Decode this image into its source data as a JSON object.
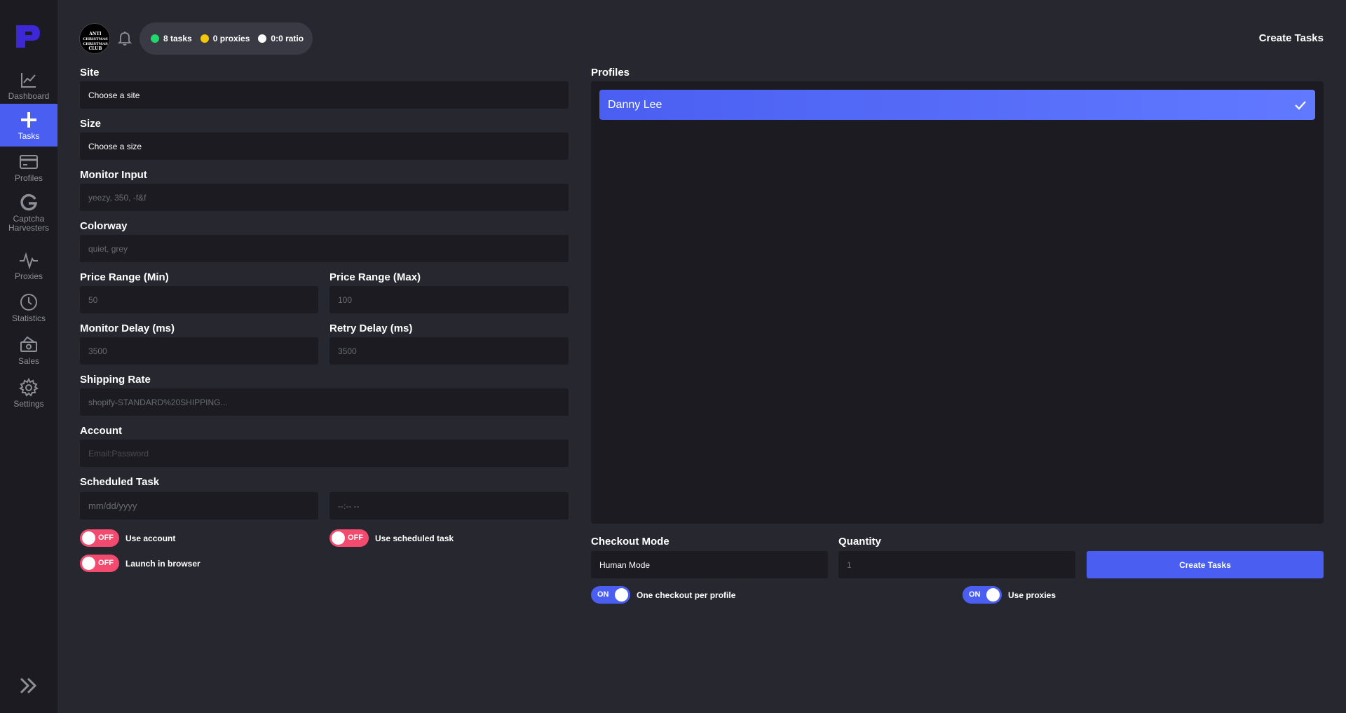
{
  "sidebar": {
    "items": [
      {
        "label": "Dashboard"
      },
      {
        "label": "Tasks"
      },
      {
        "label": "Profiles"
      },
      {
        "label": "Captcha Harvesters"
      },
      {
        "label": "Proxies"
      },
      {
        "label": "Statistics"
      },
      {
        "label": "Sales"
      },
      {
        "label": "Settings"
      }
    ],
    "active_index": 1,
    "accent": "#4a5ff1"
  },
  "header": {
    "avatar_text": "ANTI CHRISTMAS CHRISTMAS CLUB",
    "stats": {
      "tasks": "8 tasks",
      "proxies": "0 proxies",
      "ratio": "0:0 ratio"
    },
    "title": "Create Tasks"
  },
  "form": {
    "site": {
      "label": "Site",
      "value": "Choose a site"
    },
    "size": {
      "label": "Size",
      "value": "Choose a size"
    },
    "monitor_input": {
      "label": "Monitor Input",
      "placeholder": "yeezy, 350, -f&f"
    },
    "colorway": {
      "label": "Colorway",
      "placeholder": "quiet, grey"
    },
    "price_min": {
      "label": "Price Range (Min)",
      "placeholder": "50"
    },
    "price_max": {
      "label": "Price Range (Max)",
      "placeholder": "100"
    },
    "monitor_delay": {
      "label": "Monitor Delay (ms)",
      "placeholder": "3500"
    },
    "retry_delay": {
      "label": "Retry Delay (ms)",
      "placeholder": "3500"
    },
    "shipping_rate": {
      "label": "Shipping Rate",
      "placeholder": "shopify-STANDARD%20SHIPPING..."
    },
    "account": {
      "label": "Account",
      "placeholder": "Email:Password"
    },
    "scheduled": {
      "label": "Scheduled Task",
      "date_placeholder": "mm/dd/yyyy",
      "time_placeholder": "--:-- --"
    },
    "toggles": {
      "use_account": {
        "label": "Use account",
        "state": "OFF"
      },
      "use_scheduled": {
        "label": "Use scheduled task",
        "state": "OFF"
      },
      "launch_browser": {
        "label": "Launch in browser",
        "state": "OFF"
      }
    }
  },
  "profiles": {
    "label": "Profiles",
    "items": [
      {
        "name": "Danny Lee",
        "selected": true
      }
    ]
  },
  "checkout": {
    "mode_label": "Checkout Mode",
    "mode_value": "Human Mode",
    "quantity_label": "Quantity",
    "quantity_placeholder": "1",
    "create_button": "Create Tasks",
    "toggles": {
      "one_checkout": {
        "label": "One checkout per profile",
        "state": "ON"
      },
      "use_proxies": {
        "label": "Use proxies",
        "state": "ON"
      }
    }
  },
  "colors": {
    "background": "#27272f",
    "panel": "#1b1b21",
    "accent": "#4a5ff1",
    "off_toggle": "#f24b6f",
    "status_green": "#22d66b",
    "status_yellow": "#f3c60a",
    "status_white": "#ffffff"
  }
}
